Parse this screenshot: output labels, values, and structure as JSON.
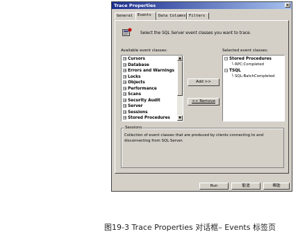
{
  "window": {
    "title": "Trace Properties",
    "close_label": "×"
  },
  "tabs": [
    {
      "label": "General",
      "active": false
    },
    {
      "label": "Events",
      "active": true
    },
    {
      "label": "Data Columns",
      "active": false
    },
    {
      "label": "Filters",
      "active": false
    }
  ],
  "instruction": "Select the SQL Server event classes you want to trace.",
  "available": {
    "label": "Available event classes:",
    "items": [
      "Cursors",
      "Database",
      "Errors and Warnings",
      "Locks",
      "Objects",
      "Performance",
      "Scans",
      "Security Audit",
      "Server",
      "Sessions",
      "Stored Procedures"
    ]
  },
  "selected": {
    "label": "Selected event classes:",
    "groups": [
      {
        "name": "Stored Procedures",
        "children": [
          "RPC:Completed"
        ]
      },
      {
        "name": "TSQL",
        "children": [
          "SQL:BatchCompleted"
        ]
      }
    ]
  },
  "buttons": {
    "add": "Add >>",
    "remove": "<< Remove",
    "run": "Run",
    "cancel": "取消",
    "help": "帮助"
  },
  "description": {
    "title": "Sessions",
    "text": "Collection of event classes that are produced by clients connecting to and disconnecting from SQL Server."
  },
  "caption": "图19-3  Trace Properties 对话框– Events  标签页"
}
